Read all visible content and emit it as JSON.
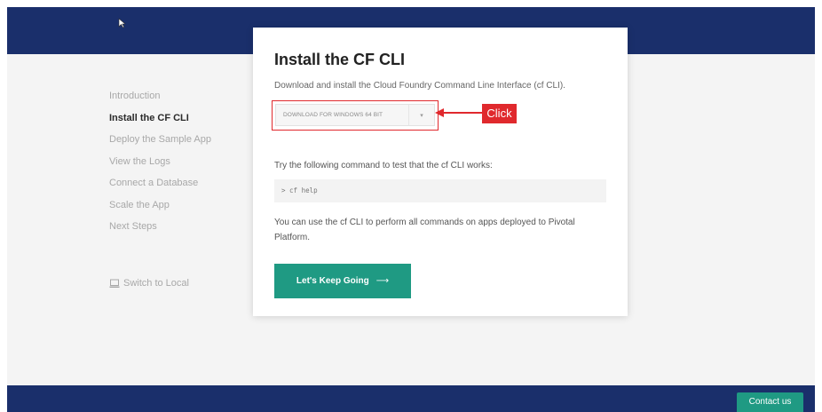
{
  "sidebar": {
    "items": [
      {
        "label": "Introduction",
        "active": false
      },
      {
        "label": "Install the CF CLI",
        "active": true
      },
      {
        "label": "Deploy the Sample App",
        "active": false
      },
      {
        "label": "View the Logs",
        "active": false
      },
      {
        "label": "Connect a Database",
        "active": false
      },
      {
        "label": "Scale the App",
        "active": false
      },
      {
        "label": "Next Steps",
        "active": false
      }
    ],
    "switch_label": "Switch to Local",
    "switch_icon": "laptop-icon"
  },
  "card": {
    "title": "Install the CF CLI",
    "description": "Download and install the Cloud Foundry Command Line Interface (cf CLI).",
    "download_label": "DOWNLOAD FOR WINDOWS 64 BIT",
    "download_caret": "▾",
    "try_text": "Try the following command to test that the cf CLI works:",
    "code_prompt": ">",
    "code_command": "cf help",
    "use_text": "You can use the cf CLI to perform all commands on apps deployed to Pivotal Platform.",
    "keep_going_label": "Let's Keep Going",
    "keep_going_arrow": "⟶"
  },
  "annotation": {
    "label": "Click",
    "color": "#e0292d"
  },
  "footer": {
    "contact_label": "Contact us"
  },
  "colors": {
    "header_navy": "#1a2f6b",
    "accent_teal": "#1f9a83",
    "highlight_red": "#e0292d"
  }
}
